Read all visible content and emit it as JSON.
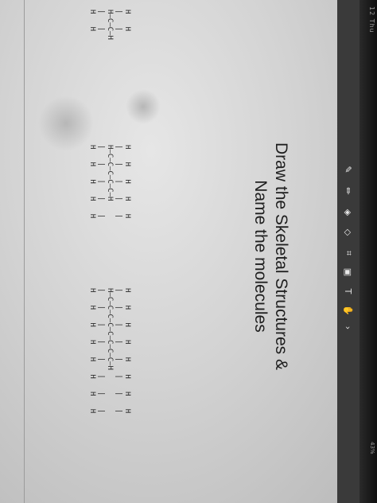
{
  "slide": {
    "title_line1": "Draw the Skeletal Structures &",
    "title_line2": "Name the molecules"
  },
  "molecules": {
    "ethane": "H   H\n|   |\nH—C—C—H\n|   |\nH   H",
    "pentane": "H   H   H   H   H\n|   |   |   |   |\nH—C—C—C—C—C—H\n|   |   |   |   |\nH   H   H   H   H",
    "octane": "H   H   H   H   H   H   H   H\n|   |   |   |   |   |   |   |\nH—C—C—C—C—C—C—C—C—H\n|   |   |   |   |   |   |   |\nH   H   H   H   H   H   H   H"
  },
  "toolbar": {
    "items": [
      "pen-icon",
      "highlighter-icon",
      "eraser-icon",
      "shapes-icon",
      "lasso-icon",
      "image-icon",
      "text-icon",
      "hand-icon",
      "chevron-icon"
    ]
  },
  "status": {
    "top": "12 Thu",
    "bottom": "43%"
  },
  "colors": {
    "background": "#d6d6d6",
    "toolbar": "#3a3a3a",
    "text": "#202020"
  }
}
